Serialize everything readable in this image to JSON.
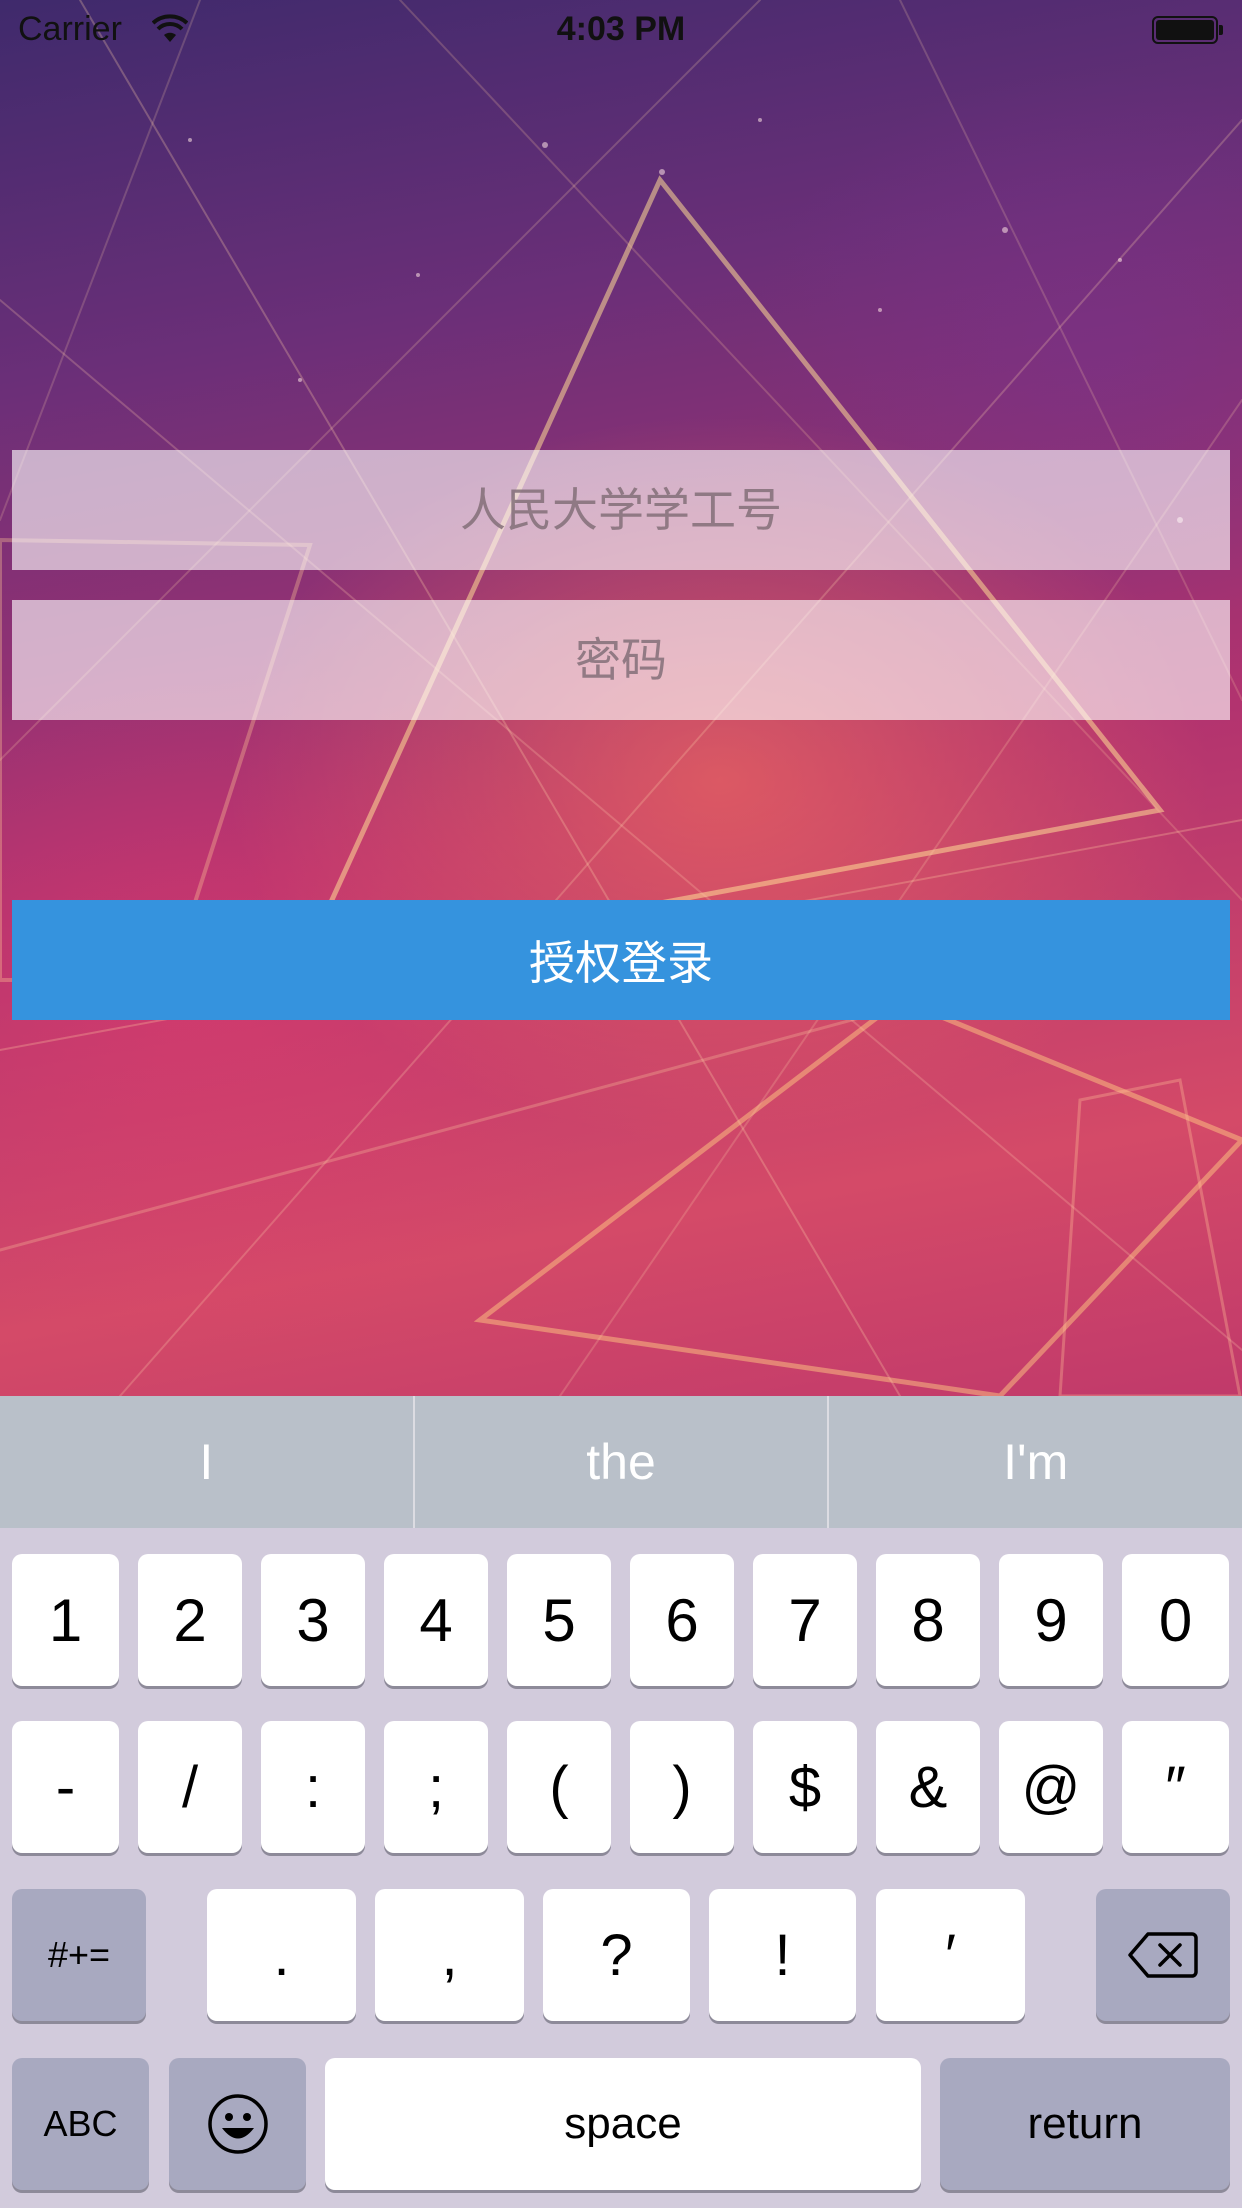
{
  "status_bar": {
    "carrier": "Carrier",
    "time": "4:03 PM",
    "wifi_icon": "wifi-icon",
    "battery_icon": "battery-icon"
  },
  "form": {
    "student_id_placeholder": "人民大学学工号",
    "student_id_value": "",
    "password_placeholder": "密码",
    "password_value": "",
    "login_button_label": "授权登录"
  },
  "keyboard": {
    "suggestions": [
      "I",
      "the",
      "I'm"
    ],
    "row1": [
      "1",
      "2",
      "3",
      "4",
      "5",
      "6",
      "7",
      "8",
      "9",
      "0"
    ],
    "row2": [
      "-",
      "/",
      ":",
      ";",
      "(",
      ")",
      "$",
      "&",
      "@",
      "″"
    ],
    "row3": {
      "shift_label": "#+=",
      "keys": [
        ".",
        ",",
        "?",
        "!",
        "′"
      ],
      "delete_icon": "backspace-icon"
    },
    "row4": {
      "abc_label": "ABC",
      "emoji_icon": "emoji-icon",
      "space_label": "space",
      "return_label": "return"
    }
  },
  "colors": {
    "login_button": "#3593de",
    "suggestion_bar": "#b9c0c9",
    "keyboard_bg": "#d2cbdc",
    "dark_key": "#a8a9c0"
  }
}
